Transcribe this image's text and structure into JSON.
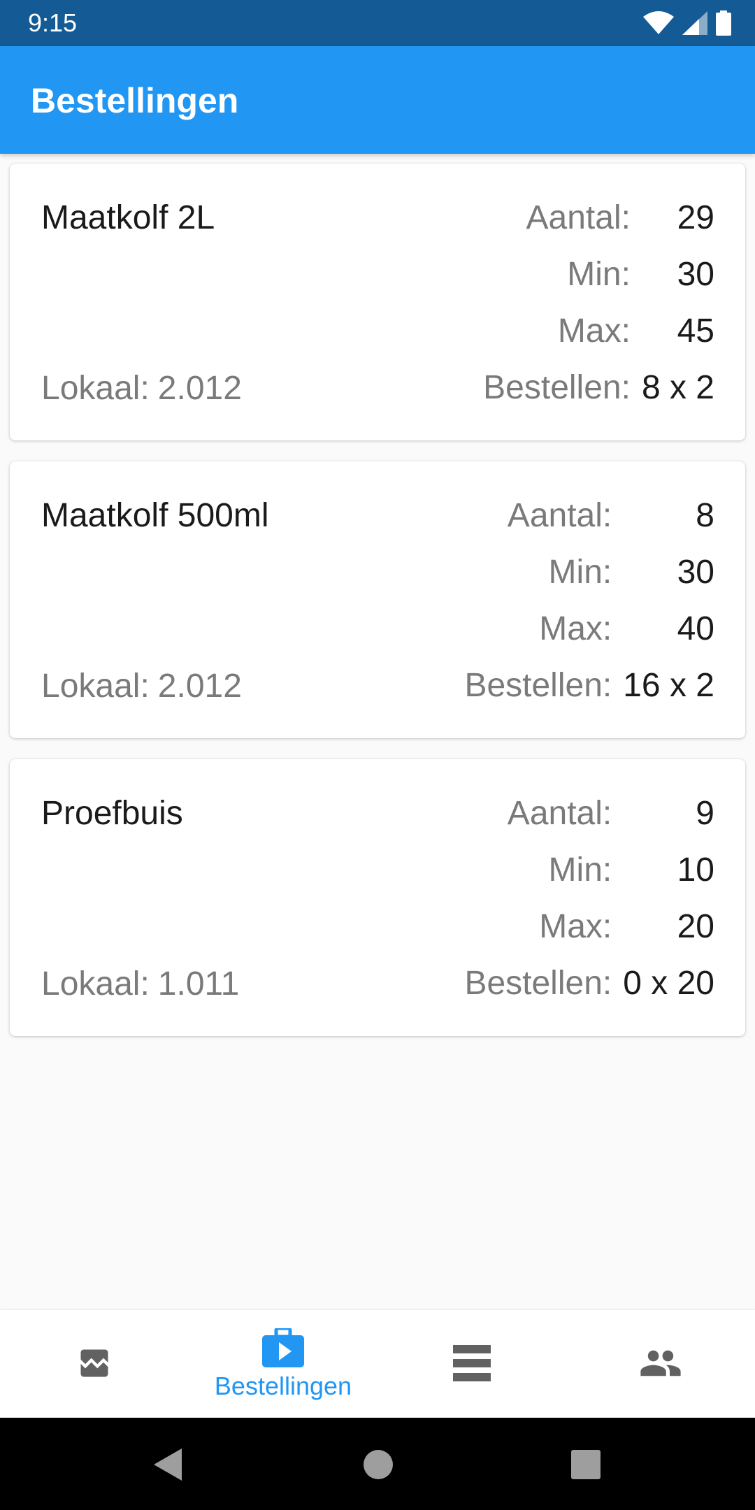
{
  "status_bar": {
    "time": "9:15",
    "icons": [
      "wifi-icon",
      "signal-icon",
      "battery-icon"
    ]
  },
  "app_bar": {
    "title": "Bestellingen"
  },
  "labels": {
    "aantal": "Aantal:",
    "min": "Min:",
    "max": "Max:",
    "bestellen": "Bestellen:",
    "lokaal": "Lokaal:"
  },
  "orders": [
    {
      "name": "Maatkolf 2L",
      "lokaal": "2.012",
      "aantal": "29",
      "min": "30",
      "max": "45",
      "bestellen": "8 x 2"
    },
    {
      "name": "Maatkolf 500ml",
      "lokaal": "2.012",
      "aantal": "8",
      "min": "30",
      "max": "40",
      "bestellen": "16 x 2"
    },
    {
      "name": "Proefbuis",
      "lokaal": "1.011",
      "aantal": "9",
      "min": "10",
      "max": "20",
      "bestellen": "0 x 20"
    }
  ],
  "bottom_nav": {
    "items": [
      {
        "icon": "chart-icon",
        "label": ""
      },
      {
        "icon": "briefcase-play-icon",
        "label": "Bestellingen",
        "active": true
      },
      {
        "icon": "list-icon",
        "label": ""
      },
      {
        "icon": "people-icon",
        "label": ""
      }
    ]
  },
  "colors": {
    "primary": "#2196F3",
    "primary_dark": "#145A94",
    "icon_inactive": "#616161",
    "text_secondary": "#7A7A7A"
  }
}
